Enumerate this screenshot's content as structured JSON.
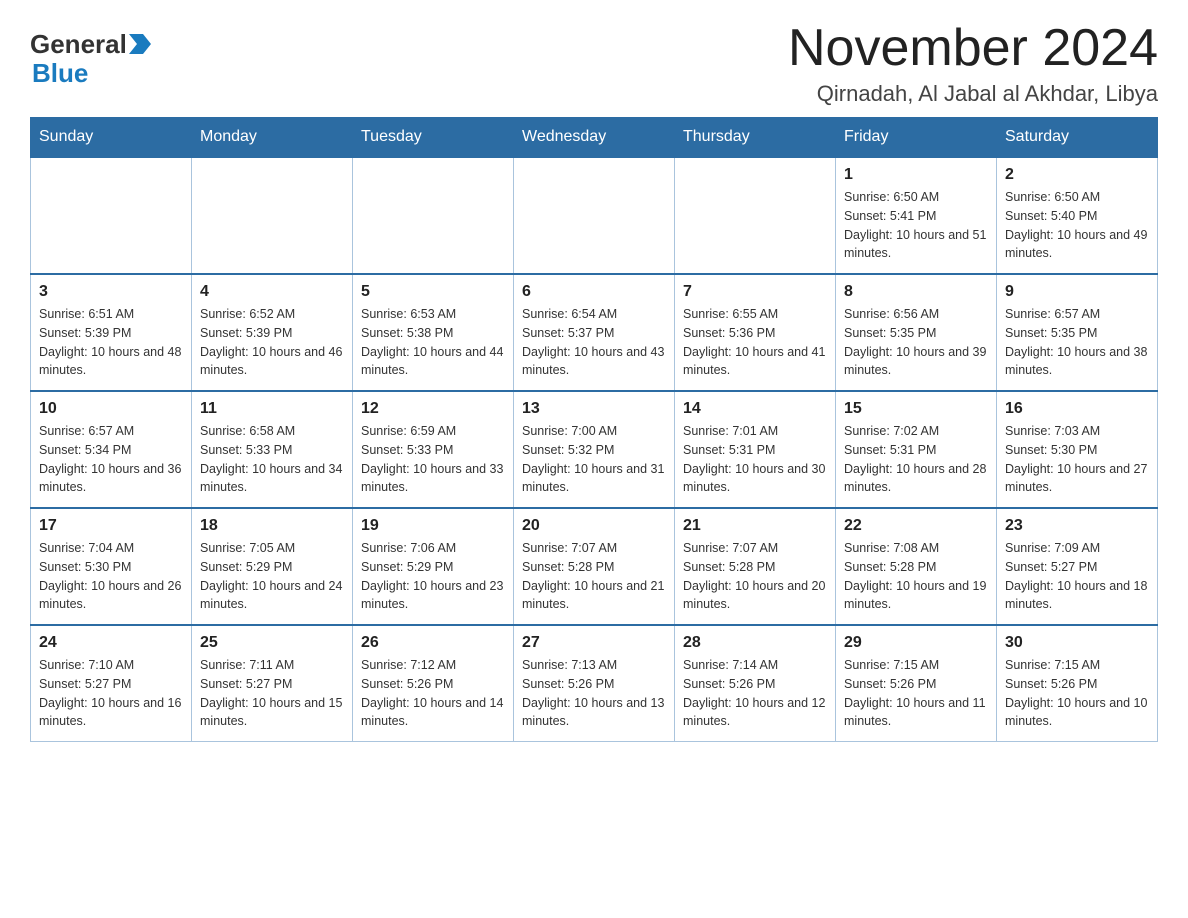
{
  "logo": {
    "general": "General",
    "blue": "Blue"
  },
  "title": {
    "month_year": "November 2024",
    "location": "Qirnadah, Al Jabal al Akhdar, Libya"
  },
  "weekdays": [
    "Sunday",
    "Monday",
    "Tuesday",
    "Wednesday",
    "Thursday",
    "Friday",
    "Saturday"
  ],
  "weeks": [
    [
      {
        "day": "",
        "sunrise": "",
        "sunset": "",
        "daylight": ""
      },
      {
        "day": "",
        "sunrise": "",
        "sunset": "",
        "daylight": ""
      },
      {
        "day": "",
        "sunrise": "",
        "sunset": "",
        "daylight": ""
      },
      {
        "day": "",
        "sunrise": "",
        "sunset": "",
        "daylight": ""
      },
      {
        "day": "",
        "sunrise": "",
        "sunset": "",
        "daylight": ""
      },
      {
        "day": "1",
        "sunrise": "Sunrise: 6:50 AM",
        "sunset": "Sunset: 5:41 PM",
        "daylight": "Daylight: 10 hours and 51 minutes."
      },
      {
        "day": "2",
        "sunrise": "Sunrise: 6:50 AM",
        "sunset": "Sunset: 5:40 PM",
        "daylight": "Daylight: 10 hours and 49 minutes."
      }
    ],
    [
      {
        "day": "3",
        "sunrise": "Sunrise: 6:51 AM",
        "sunset": "Sunset: 5:39 PM",
        "daylight": "Daylight: 10 hours and 48 minutes."
      },
      {
        "day": "4",
        "sunrise": "Sunrise: 6:52 AM",
        "sunset": "Sunset: 5:39 PM",
        "daylight": "Daylight: 10 hours and 46 minutes."
      },
      {
        "day": "5",
        "sunrise": "Sunrise: 6:53 AM",
        "sunset": "Sunset: 5:38 PM",
        "daylight": "Daylight: 10 hours and 44 minutes."
      },
      {
        "day": "6",
        "sunrise": "Sunrise: 6:54 AM",
        "sunset": "Sunset: 5:37 PM",
        "daylight": "Daylight: 10 hours and 43 minutes."
      },
      {
        "day": "7",
        "sunrise": "Sunrise: 6:55 AM",
        "sunset": "Sunset: 5:36 PM",
        "daylight": "Daylight: 10 hours and 41 minutes."
      },
      {
        "day": "8",
        "sunrise": "Sunrise: 6:56 AM",
        "sunset": "Sunset: 5:35 PM",
        "daylight": "Daylight: 10 hours and 39 minutes."
      },
      {
        "day": "9",
        "sunrise": "Sunrise: 6:57 AM",
        "sunset": "Sunset: 5:35 PM",
        "daylight": "Daylight: 10 hours and 38 minutes."
      }
    ],
    [
      {
        "day": "10",
        "sunrise": "Sunrise: 6:57 AM",
        "sunset": "Sunset: 5:34 PM",
        "daylight": "Daylight: 10 hours and 36 minutes."
      },
      {
        "day": "11",
        "sunrise": "Sunrise: 6:58 AM",
        "sunset": "Sunset: 5:33 PM",
        "daylight": "Daylight: 10 hours and 34 minutes."
      },
      {
        "day": "12",
        "sunrise": "Sunrise: 6:59 AM",
        "sunset": "Sunset: 5:33 PM",
        "daylight": "Daylight: 10 hours and 33 minutes."
      },
      {
        "day": "13",
        "sunrise": "Sunrise: 7:00 AM",
        "sunset": "Sunset: 5:32 PM",
        "daylight": "Daylight: 10 hours and 31 minutes."
      },
      {
        "day": "14",
        "sunrise": "Sunrise: 7:01 AM",
        "sunset": "Sunset: 5:31 PM",
        "daylight": "Daylight: 10 hours and 30 minutes."
      },
      {
        "day": "15",
        "sunrise": "Sunrise: 7:02 AM",
        "sunset": "Sunset: 5:31 PM",
        "daylight": "Daylight: 10 hours and 28 minutes."
      },
      {
        "day": "16",
        "sunrise": "Sunrise: 7:03 AM",
        "sunset": "Sunset: 5:30 PM",
        "daylight": "Daylight: 10 hours and 27 minutes."
      }
    ],
    [
      {
        "day": "17",
        "sunrise": "Sunrise: 7:04 AM",
        "sunset": "Sunset: 5:30 PM",
        "daylight": "Daylight: 10 hours and 26 minutes."
      },
      {
        "day": "18",
        "sunrise": "Sunrise: 7:05 AM",
        "sunset": "Sunset: 5:29 PM",
        "daylight": "Daylight: 10 hours and 24 minutes."
      },
      {
        "day": "19",
        "sunrise": "Sunrise: 7:06 AM",
        "sunset": "Sunset: 5:29 PM",
        "daylight": "Daylight: 10 hours and 23 minutes."
      },
      {
        "day": "20",
        "sunrise": "Sunrise: 7:07 AM",
        "sunset": "Sunset: 5:28 PM",
        "daylight": "Daylight: 10 hours and 21 minutes."
      },
      {
        "day": "21",
        "sunrise": "Sunrise: 7:07 AM",
        "sunset": "Sunset: 5:28 PM",
        "daylight": "Daylight: 10 hours and 20 minutes."
      },
      {
        "day": "22",
        "sunrise": "Sunrise: 7:08 AM",
        "sunset": "Sunset: 5:28 PM",
        "daylight": "Daylight: 10 hours and 19 minutes."
      },
      {
        "day": "23",
        "sunrise": "Sunrise: 7:09 AM",
        "sunset": "Sunset: 5:27 PM",
        "daylight": "Daylight: 10 hours and 18 minutes."
      }
    ],
    [
      {
        "day": "24",
        "sunrise": "Sunrise: 7:10 AM",
        "sunset": "Sunset: 5:27 PM",
        "daylight": "Daylight: 10 hours and 16 minutes."
      },
      {
        "day": "25",
        "sunrise": "Sunrise: 7:11 AM",
        "sunset": "Sunset: 5:27 PM",
        "daylight": "Daylight: 10 hours and 15 minutes."
      },
      {
        "day": "26",
        "sunrise": "Sunrise: 7:12 AM",
        "sunset": "Sunset: 5:26 PM",
        "daylight": "Daylight: 10 hours and 14 minutes."
      },
      {
        "day": "27",
        "sunrise": "Sunrise: 7:13 AM",
        "sunset": "Sunset: 5:26 PM",
        "daylight": "Daylight: 10 hours and 13 minutes."
      },
      {
        "day": "28",
        "sunrise": "Sunrise: 7:14 AM",
        "sunset": "Sunset: 5:26 PM",
        "daylight": "Daylight: 10 hours and 12 minutes."
      },
      {
        "day": "29",
        "sunrise": "Sunrise: 7:15 AM",
        "sunset": "Sunset: 5:26 PM",
        "daylight": "Daylight: 10 hours and 11 minutes."
      },
      {
        "day": "30",
        "sunrise": "Sunrise: 7:15 AM",
        "sunset": "Sunset: 5:26 PM",
        "daylight": "Daylight: 10 hours and 10 minutes."
      }
    ]
  ]
}
